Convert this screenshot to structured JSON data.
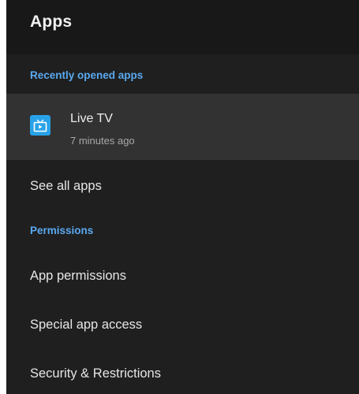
{
  "header": {
    "title": "Apps"
  },
  "recent": {
    "section_label": "Recently opened apps",
    "apps": [
      {
        "name": "Live TV",
        "time": "7 minutes ago",
        "icon": "live-tv-icon",
        "icon_color": "#29a2e8"
      }
    ]
  },
  "see_all": {
    "label": "See all apps"
  },
  "permissions": {
    "section_label": "Permissions",
    "items": [
      {
        "label": "App permissions"
      },
      {
        "label": "Special app access"
      },
      {
        "label": "Security & Restrictions"
      }
    ]
  },
  "colors": {
    "accent": "#5aa9f0",
    "panel_background": "#1f1f1f",
    "header_background": "#181818",
    "selected_row": "#323232"
  }
}
